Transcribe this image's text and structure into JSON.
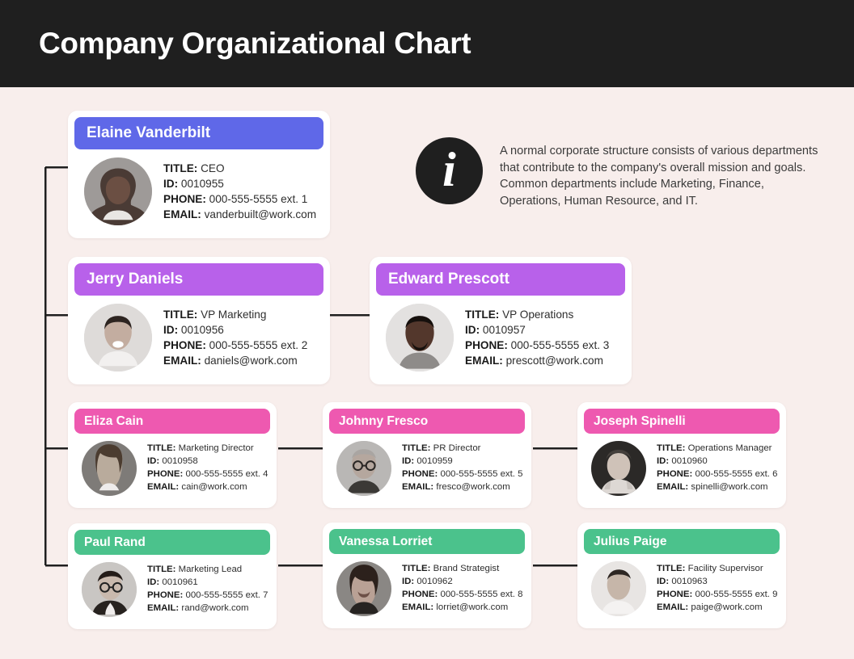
{
  "page": {
    "title": "Company Organizational Chart",
    "background_color": "#f8eeec",
    "header_background": "#1f1f1f",
    "header_text_color": "#ffffff"
  },
  "info_callout": {
    "icon": "info-circle-icon",
    "icon_glyph": "i",
    "text": "A normal corporate structure consists of various departments that contribute to the company's overall mission and goals. Common departments include Marketing, Finance, Operations, Human Resource, and IT."
  },
  "field_labels": {
    "title": "TITLE:",
    "id": "ID:",
    "phone": "PHONE:",
    "email": "EMAIL:"
  },
  "level_colors": {
    "executive": "#5f68e8",
    "vice_president": "#b861ea",
    "director": "#ee59b0",
    "staff": "#4bc28c"
  },
  "connector_color": "#1f1f1f",
  "levels": [
    {
      "name": "executive",
      "color": "#5f68e8",
      "people": [
        {
          "name": "Elaine Vanderbilt",
          "title": "CEO",
          "id": "0010955",
          "phone": "000-555-5555 ext. 1",
          "email": "vanderbuilt@work.com"
        }
      ]
    },
    {
      "name": "vice_president",
      "color": "#b861ea",
      "people": [
        {
          "name": "Jerry Daniels",
          "title": "VP Marketing",
          "id": "0010956",
          "phone": "000-555-5555 ext. 2",
          "email": "daniels@work.com"
        },
        {
          "name": "Edward Prescott",
          "title": "VP Operations",
          "id": "0010957",
          "phone": "000-555-5555 ext. 3",
          "email": "prescott@work.com"
        }
      ]
    },
    {
      "name": "director",
      "color": "#ee59b0",
      "people": [
        {
          "name": "Eliza Cain",
          "title": "Marketing Director",
          "id": "0010958",
          "phone": "000-555-5555 ext. 4",
          "email": "cain@work.com"
        },
        {
          "name": "Johnny Fresco",
          "title": "PR Director",
          "id": "0010959",
          "phone": "000-555-5555 ext. 5",
          "email": "fresco@work.com"
        },
        {
          "name": "Joseph Spinelli",
          "title": "Operations Manager",
          "id": "0010960",
          "phone": "000-555-5555 ext. 6",
          "email": "spinelli@work.com"
        }
      ]
    },
    {
      "name": "staff",
      "color": "#4bc28c",
      "people": [
        {
          "name": "Paul Rand",
          "title": "Marketing Lead",
          "id": "0010961",
          "phone": "000-555-5555 ext. 7",
          "email": "rand@work.com"
        },
        {
          "name": "Vanessa Lorriet",
          "title": "Brand Strategist",
          "id": "0010962",
          "phone": "000-555-5555 ext. 8",
          "email": "lorriet@work.com"
        },
        {
          "name": "Julius Paige",
          "title": "Facility Supervisor",
          "id": "0010963",
          "phone": "000-555-5555 ext. 9",
          "email": "paige@work.com"
        }
      ]
    }
  ]
}
